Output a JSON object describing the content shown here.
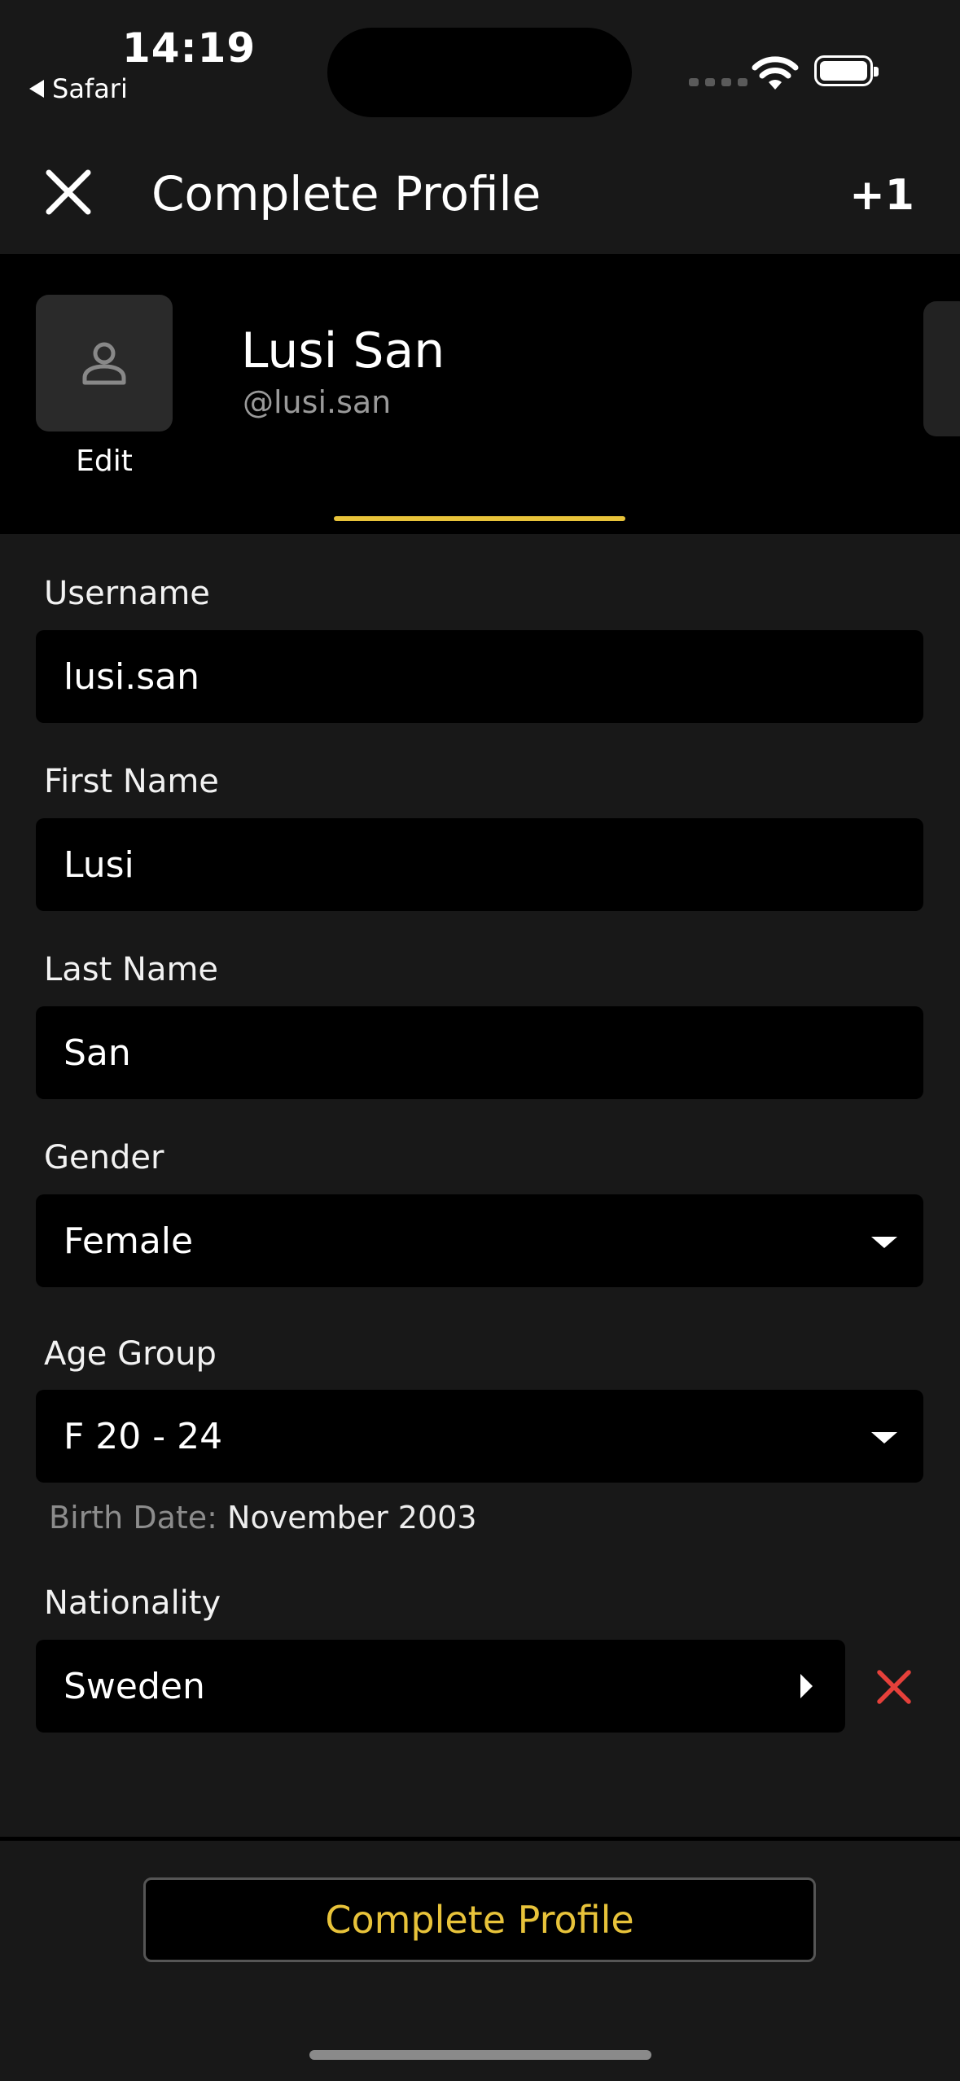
{
  "status_bar": {
    "time": "14:19",
    "back_app": "Safari"
  },
  "header": {
    "title": "Complete Profile",
    "action": "+1"
  },
  "profile": {
    "name": "Lusi San",
    "handle": "@lusi.san",
    "edit_label": "Edit"
  },
  "form": {
    "username": {
      "label": "Username",
      "value": "lusi.san"
    },
    "first_name": {
      "label": "First Name",
      "value": "Lusi"
    },
    "last_name": {
      "label": "Last Name",
      "value": "San"
    },
    "gender": {
      "label": "Gender",
      "value": "Female"
    },
    "age_group": {
      "label": "Age Group",
      "value": "F 20 - 24"
    },
    "birth_date": {
      "label": "Birth Date:",
      "value": "November 2003"
    },
    "nationality": {
      "label": "Nationality",
      "value": "Sweden"
    }
  },
  "footer": {
    "button_label": "Complete Profile"
  },
  "colors": {
    "accent": "#e8c33a",
    "danger": "#e5403a",
    "background": "#181818",
    "field": "#000000"
  }
}
